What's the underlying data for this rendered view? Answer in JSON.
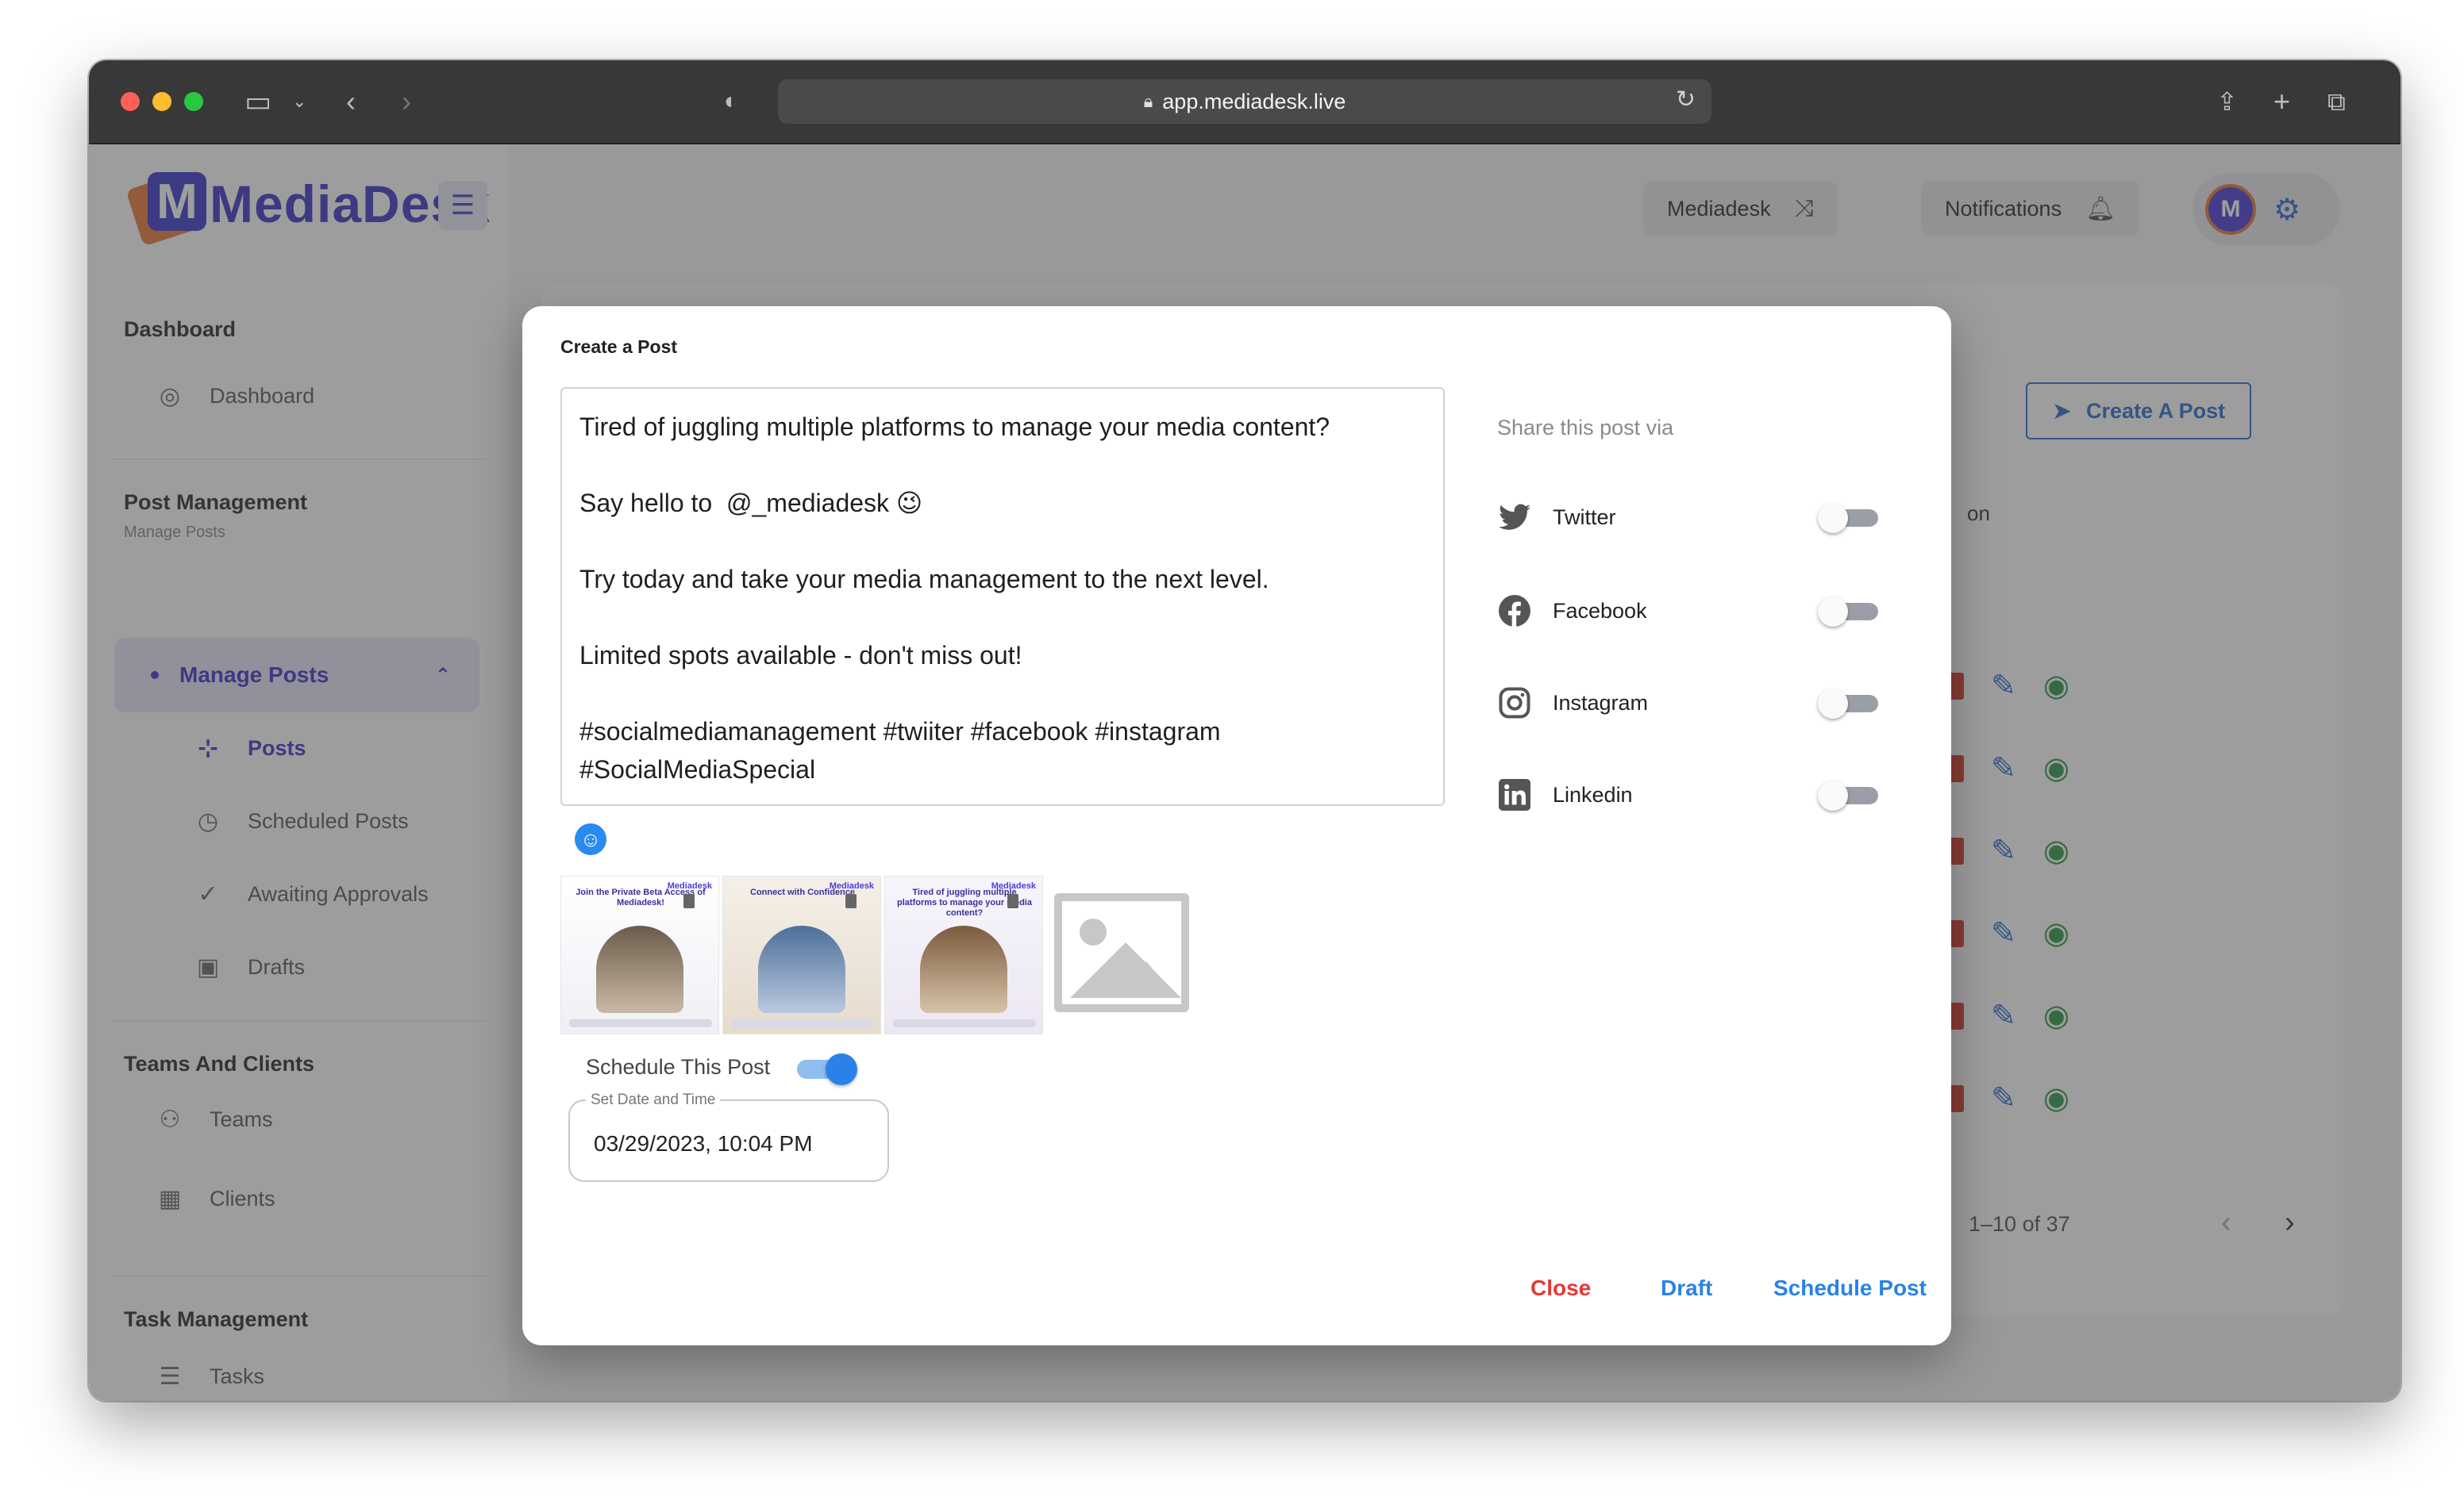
{
  "browser": {
    "url": "app.mediadesk.live"
  },
  "app": {
    "logo_text": "MediaDesk",
    "logo_mark": "M"
  },
  "sidebar": {
    "sections": {
      "dashboard": "Dashboard",
      "post_management": "Post Management",
      "post_management_sub": "Manage Posts",
      "teams_clients": "Teams And Clients",
      "task_management": "Task Management"
    },
    "items": {
      "dashboard": "Dashboard",
      "manage_posts": "Manage Posts",
      "posts": "Posts",
      "scheduled_posts": "Scheduled Posts",
      "awaiting_approvals": "Awaiting Approvals",
      "drafts": "Drafts",
      "teams": "Teams",
      "clients": "Clients",
      "tasks": "Tasks"
    }
  },
  "topbar": {
    "workspace": "Mediadesk",
    "notifications": "Notifications",
    "avatar_initial": "M"
  },
  "background": {
    "create_post_button": "Create A Post",
    "column_header_fragment": "on",
    "pagination": "1–10 of 37"
  },
  "modal": {
    "title": "Create a Post",
    "post_text": "Tired of juggling multiple platforms to manage your media content?\n\nSay hello to  @_mediadesk 😉\n\nTry today and take your media management to the next level.\n\nLimited spots available - don't miss out!\n\n#socialmediamanagement #twiiter #facebook #instagram\n#SocialMediaSpecial",
    "thumbnails": [
      {
        "caption": "Join the Private Beta Access of Mediadesk!",
        "brand": "Mediadesk"
      },
      {
        "caption": "Connect with Confidence",
        "brand": "Mediadesk"
      },
      {
        "caption": "Tired of juggling multiple platforms to manage your media content?",
        "brand": "Mediadesk"
      }
    ],
    "schedule_label": "Schedule This Post",
    "date_label": "Set Date and Time",
    "date_value": "03/29/2023, 10:04 PM",
    "share_title": "Share this post via",
    "share_options": {
      "twitter": "Twitter",
      "facebook": "Facebook",
      "instagram": "Instagram",
      "linkedin": "Linkedin"
    },
    "buttons": {
      "close": "Close",
      "draft": "Draft",
      "schedule": "Schedule Post"
    }
  },
  "colors": {
    "brand": "#3f36c8",
    "primary_action": "#2a82e8",
    "danger": "#e53935"
  }
}
